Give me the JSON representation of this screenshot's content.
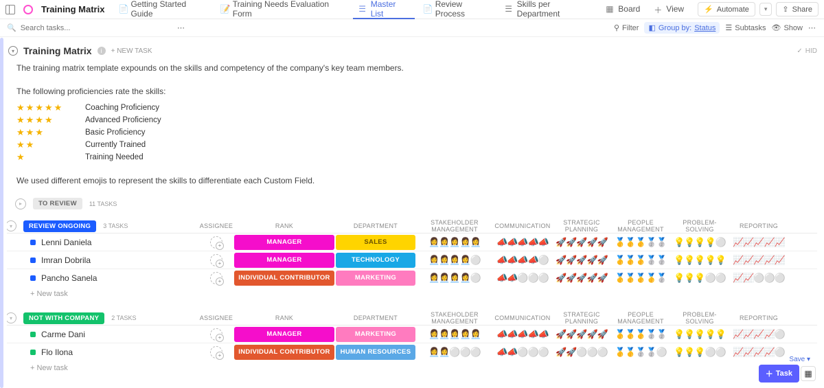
{
  "header": {
    "title": "Training Matrix",
    "tabs": [
      {
        "icon": "doc-icon",
        "label": "Getting Started Guide"
      },
      {
        "icon": "form-icon",
        "label": "Training Needs Evaluation Form"
      },
      {
        "icon": "list-icon",
        "label": "Master List",
        "active": true
      },
      {
        "icon": "doc-icon",
        "label": "Review Process"
      },
      {
        "icon": "list-icon",
        "label": "Skills per Department"
      },
      {
        "icon": "board-icon",
        "label": "Board"
      },
      {
        "icon": "plus-icon",
        "label": "View"
      }
    ],
    "automate": "Automate",
    "share": "Share"
  },
  "toolbar": {
    "search_placeholder": "Search tasks...",
    "filter": "Filter",
    "group_by_label": "Group by:",
    "group_by_value": "Status",
    "subtasks": "Subtasks",
    "show": "Show"
  },
  "list": {
    "title": "Training Matrix",
    "new_task": "+ NEW TASK",
    "hide": "HID",
    "description": "The training matrix template expounds on the skills and competency of the company's key team members.",
    "prof_intro": "The following proficiencies rate the skills:",
    "proficiency": [
      {
        "stars": 5,
        "label": "Coaching Proficiency"
      },
      {
        "stars": 4,
        "label": "Advanced Proficiency"
      },
      {
        "stars": 3,
        "label": "Basic Proficiency"
      },
      {
        "stars": 2,
        "label": "Currently Trained"
      },
      {
        "stars": 1,
        "label": "Training Needed"
      }
    ],
    "emoji_note": "We used different emojis to represent the skills to differentiate each Custom Field."
  },
  "columns": {
    "assignee": "ASSIGNEE",
    "rank": "RANK",
    "department": "DEPARTMENT",
    "stakeholder": "STAKEHOLDER MANAGEMENT",
    "communication": "COMMUNICATION",
    "strategic": "STRATEGIC PLANNING",
    "people": "PEOPLE MANAGEMENT",
    "problem": "PROBLEM-SOLVING",
    "reporting": "REPORTING"
  },
  "groups": {
    "to_review": {
      "label": "TO REVIEW",
      "count": "11 TASKS"
    },
    "review_ongoing": {
      "label": "REVIEW ONGOING",
      "count": "3 TASKS",
      "tasks": [
        {
          "name": "Lenni Daniela",
          "rank": "MANAGER",
          "rank_cls": "rank-mgr",
          "dept": "SALES",
          "dept_cls": "dept-sales",
          "stakeholder": "👩‍💼👩‍💼👩‍💼👩‍💼👩‍💼",
          "communication": "📣📣📣📣📣",
          "strategic": "🚀🚀🚀🚀🚀",
          "people": "🥇🥇🥇🥈🥈",
          "problem": "💡💡💡💡⚪",
          "reporting": "📈📈📈📈📈"
        },
        {
          "name": "Imran Dobrila",
          "rank": "MANAGER",
          "rank_cls": "rank-mgr",
          "dept": "TECHNOLOGY",
          "dept_cls": "dept-tech",
          "stakeholder": "👩‍💼👩‍💼👩‍💼👩‍💼⚪",
          "communication": "📣📣📣📣⚪",
          "strategic": "🚀🚀🚀🚀🚀",
          "people": "🥇🥇🥇🥈🥈",
          "problem": "💡💡💡💡💡",
          "reporting": "📈📈📈📈📈"
        },
        {
          "name": "Pancho Sanela",
          "rank": "INDIVIDUAL CONTRIBUTOR",
          "rank_cls": "rank-ic",
          "dept": "MARKETING",
          "dept_cls": "dept-mkt",
          "stakeholder": "👩‍💼👩‍💼👩‍💼👩‍💼⚪",
          "communication": "📣📣⚪⚪⚪",
          "strategic": "🚀🚀🚀🚀🚀",
          "people": "🥇🥇🥇🥇🥈",
          "problem": "💡💡💡⚪⚪",
          "reporting": "📈📈⚪⚪⚪"
        }
      ],
      "add": "+ New task"
    },
    "not_with_company": {
      "label": "NOT WITH COMPANY",
      "count": "2 TASKS",
      "tasks": [
        {
          "name": "Carme Dani",
          "rank": "MANAGER",
          "rank_cls": "rank-mgr",
          "dept": "MARKETING",
          "dept_cls": "dept-mkt",
          "stakeholder": "👩‍💼👩‍💼👩‍💼👩‍💼👩‍💼",
          "communication": "📣📣📣📣📣",
          "strategic": "🚀🚀🚀🚀🚀",
          "people": "🥇🥇🥇🥈🥈",
          "problem": "💡💡💡💡💡",
          "reporting": "📈📈📈📈⚪"
        },
        {
          "name": "Flo Ilona",
          "rank": "INDIVIDUAL CONTRIBUTOR",
          "rank_cls": "rank-ic",
          "dept": "HUMAN RESOURCES",
          "dept_cls": "dept-hr",
          "stakeholder": "👩‍💼👩‍💼⚪⚪⚪",
          "communication": "📣📣⚪⚪⚪",
          "strategic": "🚀🚀⚪⚪⚪",
          "people": "🥇🥇🥈🥈⚪",
          "problem": "💡💡💡⚪⚪",
          "reporting": "📈📈📈📈⚪"
        }
      ],
      "add": "+ New task"
    }
  },
  "floating": {
    "save": "Save ▾",
    "task": "Task"
  }
}
